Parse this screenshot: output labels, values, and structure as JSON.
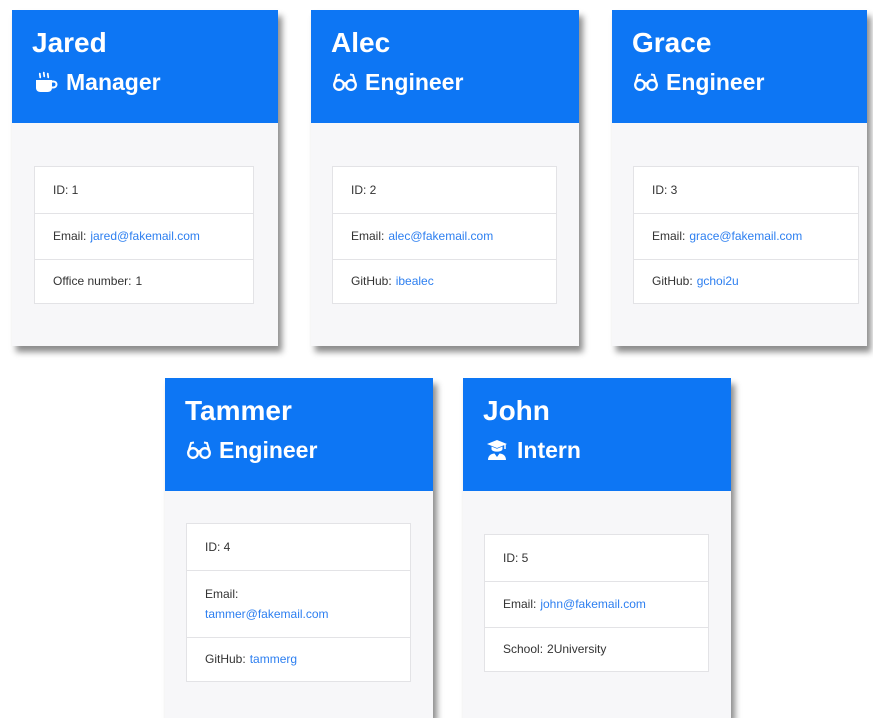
{
  "employees": [
    {
      "name": "Jared",
      "role": "Manager",
      "role_icon": "mug-icon",
      "id_text": "ID: 1",
      "email_label": "Email:",
      "email": "jared@fakemail.com",
      "extra_label": "Office number:",
      "extra_value": "1"
    },
    {
      "name": "Alec",
      "role": "Engineer",
      "role_icon": "glasses-icon",
      "id_text": "ID: 2",
      "email_label": "Email:",
      "email": "alec@fakemail.com",
      "extra_label": "GitHub:",
      "extra_value": "ibealec"
    },
    {
      "name": "Grace",
      "role": "Engineer",
      "role_icon": "glasses-icon",
      "id_text": "ID: 3",
      "email_label": "Email:",
      "email": "grace@fakemail.com",
      "extra_label": "GitHub:",
      "extra_value": "gchoi2u"
    },
    {
      "name": "Tammer",
      "role": "Engineer",
      "role_icon": "glasses-icon",
      "id_text": "ID: 4",
      "email_label": "Email:",
      "email": "tammer@fakemail.com",
      "extra_label": "GitHub:",
      "extra_value": "tammerg"
    },
    {
      "name": "John",
      "role": "Intern",
      "role_icon": "graduate-icon",
      "id_text": "ID: 5",
      "email_label": "Email:",
      "email": "john@fakemail.com",
      "extra_label": "School:",
      "extra_value": "2University"
    }
  ],
  "colors": {
    "header": "#0d76f4",
    "link": "#2d7ff0",
    "card_body": "#f7f7f9"
  }
}
